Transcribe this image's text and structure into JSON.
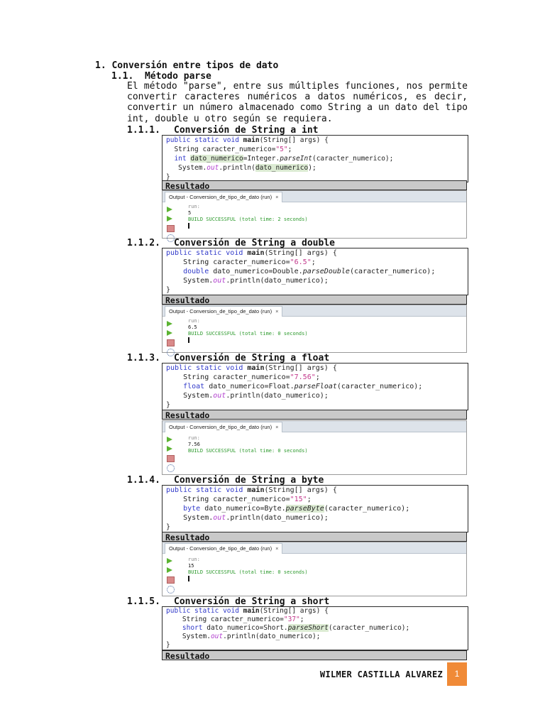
{
  "heading1": "1. Conversión entre tipos de dato",
  "heading2": "1.1.  Método parse",
  "paragraph": "El método \"parse\", entre sus múltiples funciones, nos permite convertir caracteres numéricos a datos numéricos, es decir, convertir un número almacenado como String a un dato del tipo int, double u otro según se requiera.",
  "result_label": "Resultado",
  "output_tab": "Output - Conversion_de_tipo_de_dato (run)",
  "output_close": "×",
  "output_run": "run:",
  "sections": [
    {
      "num": "1.1.1.",
      "title": "Conversión de String a int",
      "line1_kw": "public static void ",
      "line1_m": "main",
      "line1_rest": "(String[] args) {",
      "line2_a": "String caracter_numerico=",
      "line2_str": "\"5\"",
      "line2_b": ";",
      "line3_type": "int",
      "line3_var": "dato_numerico",
      "line3_a": "=Integer.",
      "line3_m": "parseInt",
      "line3_b": "(caracter_numerico);",
      "line4_a": "System.",
      "line4_out": "out",
      "line4_b": ".println(",
      "line4_var": "dato_numerico",
      "line4_c": ");",
      "line5": "}",
      "result_value": "5",
      "build": "BUILD SUCCESSFUL (total time: 2 seconds)"
    },
    {
      "num": "1.1.2.",
      "title": "Conversión de String a double",
      "line1_kw": "public static void ",
      "line1_m": "main",
      "line1_rest": "(String[] args) {",
      "line2_a": "String caracter_numerico=",
      "line2_str": "\"6.5\"",
      "line2_b": ";",
      "line3_type": "double",
      "line3_var": "dato_numerico",
      "line3_a": "=Double.",
      "line3_m": "parseDouble",
      "line3_b": "(caracter_numerico);",
      "line4_a": "System.",
      "line4_out": "out",
      "line4_b": ".println(",
      "line4_var": "dato_numerico",
      "line4_c": ");",
      "line5": "}",
      "result_value": "6.5",
      "build": "BUILD SUCCESSFUL (total time: 0 seconds)"
    },
    {
      "num": "1.1.3.",
      "title": "Conversión de String a float",
      "line1_kw": "public static void ",
      "line1_m": "main",
      "line1_rest": "(String[] args) {",
      "line2_a": "String caracter_numerico=",
      "line2_str": "\"7.56\"",
      "line2_b": ";",
      "line3_type": "float",
      "line3_var": "dato_numerico",
      "line3_a": "=Float.",
      "line3_m": "parseFloat",
      "line3_b": "(caracter_numerico);",
      "line4_a": "System.",
      "line4_out": "out",
      "line4_b": ".println(",
      "line4_var": "dato_numerico",
      "line4_c": ");",
      "line5": "}",
      "result_value": "7.56",
      "build": "BUILD SUCCESSFUL (total time: 0 seconds)"
    },
    {
      "num": "1.1.4.",
      "title": "Conversión de String a byte",
      "line1_kw": "public static void ",
      "line1_m": "main",
      "line1_rest": "(String[] args) {",
      "line2_a": "String caracter_numerico=",
      "line2_str": "\"15\"",
      "line2_b": ";",
      "line3_type": "byte",
      "line3_var": "dato_numerico",
      "line3_a": "=Byte.",
      "line3_m": "parseByte",
      "line3_b": "(caracter_numerico);",
      "line4_a": "System.",
      "line4_out": "out",
      "line4_b": ".println(",
      "line4_var": "dato_numerico",
      "line4_c": ");",
      "line5": "}",
      "result_value": "15",
      "build": "BUILD SUCCESSFUL (total time: 0 seconds)"
    },
    {
      "num": "1.1.5.",
      "title": "Conversión de String a short",
      "line1_kw": "public static void ",
      "line1_m": "main",
      "line1_rest": "(String[] args) {",
      "line2_a": "String caracter_numerico=",
      "line2_str": "\"37\"",
      "line2_b": ";",
      "line3_type": "short",
      "line3_var": "dato_numerico",
      "line3_a": "=Short.",
      "line3_m": "parseShort",
      "line3_b": "(caracter_numerico);",
      "line4_a": "System.",
      "line4_out": "out",
      "line4_b": ".println(",
      "line4_var": "dato_numerico",
      "line4_c": ");",
      "line5": "}"
    }
  ],
  "footer": {
    "author": "WILMER CASTILLA ALVAREZ",
    "page": "1"
  },
  "colors": {
    "accent": "#f08a37",
    "keyword": "#2f38c9",
    "string": "#c3388c",
    "success": "#2d9a2d"
  }
}
